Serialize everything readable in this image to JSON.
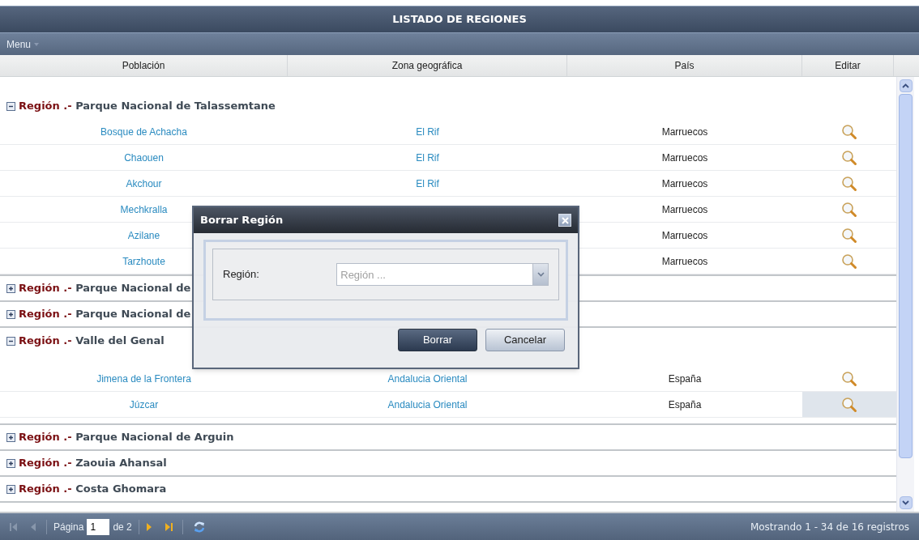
{
  "window": {
    "title": "LISTADO DE REGIONES"
  },
  "menu": {
    "label": "Menu"
  },
  "table": {
    "columns": [
      "Población",
      "Zona geográfica",
      "País",
      "Editar"
    ],
    "groups": [
      {
        "prefix": "Región .-",
        "name": "Parque Nacional de Talassemtane",
        "expanded": true,
        "rows": [
          {
            "poblacion": "Bosque de Achacha",
            "zona": "El Rif",
            "pais": "Marruecos",
            "hovered": false
          },
          {
            "poblacion": "Chaouen",
            "zona": "El Rif",
            "pais": "Marruecos",
            "hovered": false
          },
          {
            "poblacion": "Akchour",
            "zona": "El Rif",
            "pais": "Marruecos",
            "hovered": false
          },
          {
            "poblacion": "Mechkralla",
            "pais": "Marruecos",
            "hovered": false
          },
          {
            "poblacion": "Azilane",
            "pais": "Marruecos",
            "hovered": false
          },
          {
            "poblacion": "Tarzhoute",
            "pais": "Marruecos",
            "hovered": false
          }
        ]
      },
      {
        "prefix": "Región .-",
        "name": "Parque Nacional de",
        "expanded": false
      },
      {
        "prefix": "Región .-",
        "name": "Parque Nacional de",
        "expanded": false
      },
      {
        "prefix": "Región .-",
        "name": "Valle del Genal",
        "expanded": true,
        "rows": [
          {
            "poblacion": "Jimena de la Frontera",
            "zona": "Andalucia Oriental",
            "pais": "España",
            "hovered": false
          },
          {
            "poblacion": "Júzcar",
            "zona": "Andalucia Oriental",
            "pais": "España",
            "hovered": true
          }
        ]
      },
      {
        "prefix": "Región .-",
        "name": "Parque Nacional de Arguin",
        "expanded": false
      },
      {
        "prefix": "Región .-",
        "name": "Zaouia Ahansal",
        "expanded": false
      },
      {
        "prefix": "Región .-",
        "name": "Costa Ghomara",
        "expanded": false
      }
    ]
  },
  "pager": {
    "page_label": "Página",
    "page": "1",
    "of": "de 2",
    "summary": "Mostrando 1 - 34 de 16 registros"
  },
  "dialog": {
    "title": "Borrar Región",
    "field_label": "Región:",
    "placeholder": "Región ...",
    "buttons": [
      {
        "label": "Borrar",
        "kind": "primary"
      },
      {
        "label": "Cancelar",
        "kind": "secondary"
      }
    ]
  }
}
